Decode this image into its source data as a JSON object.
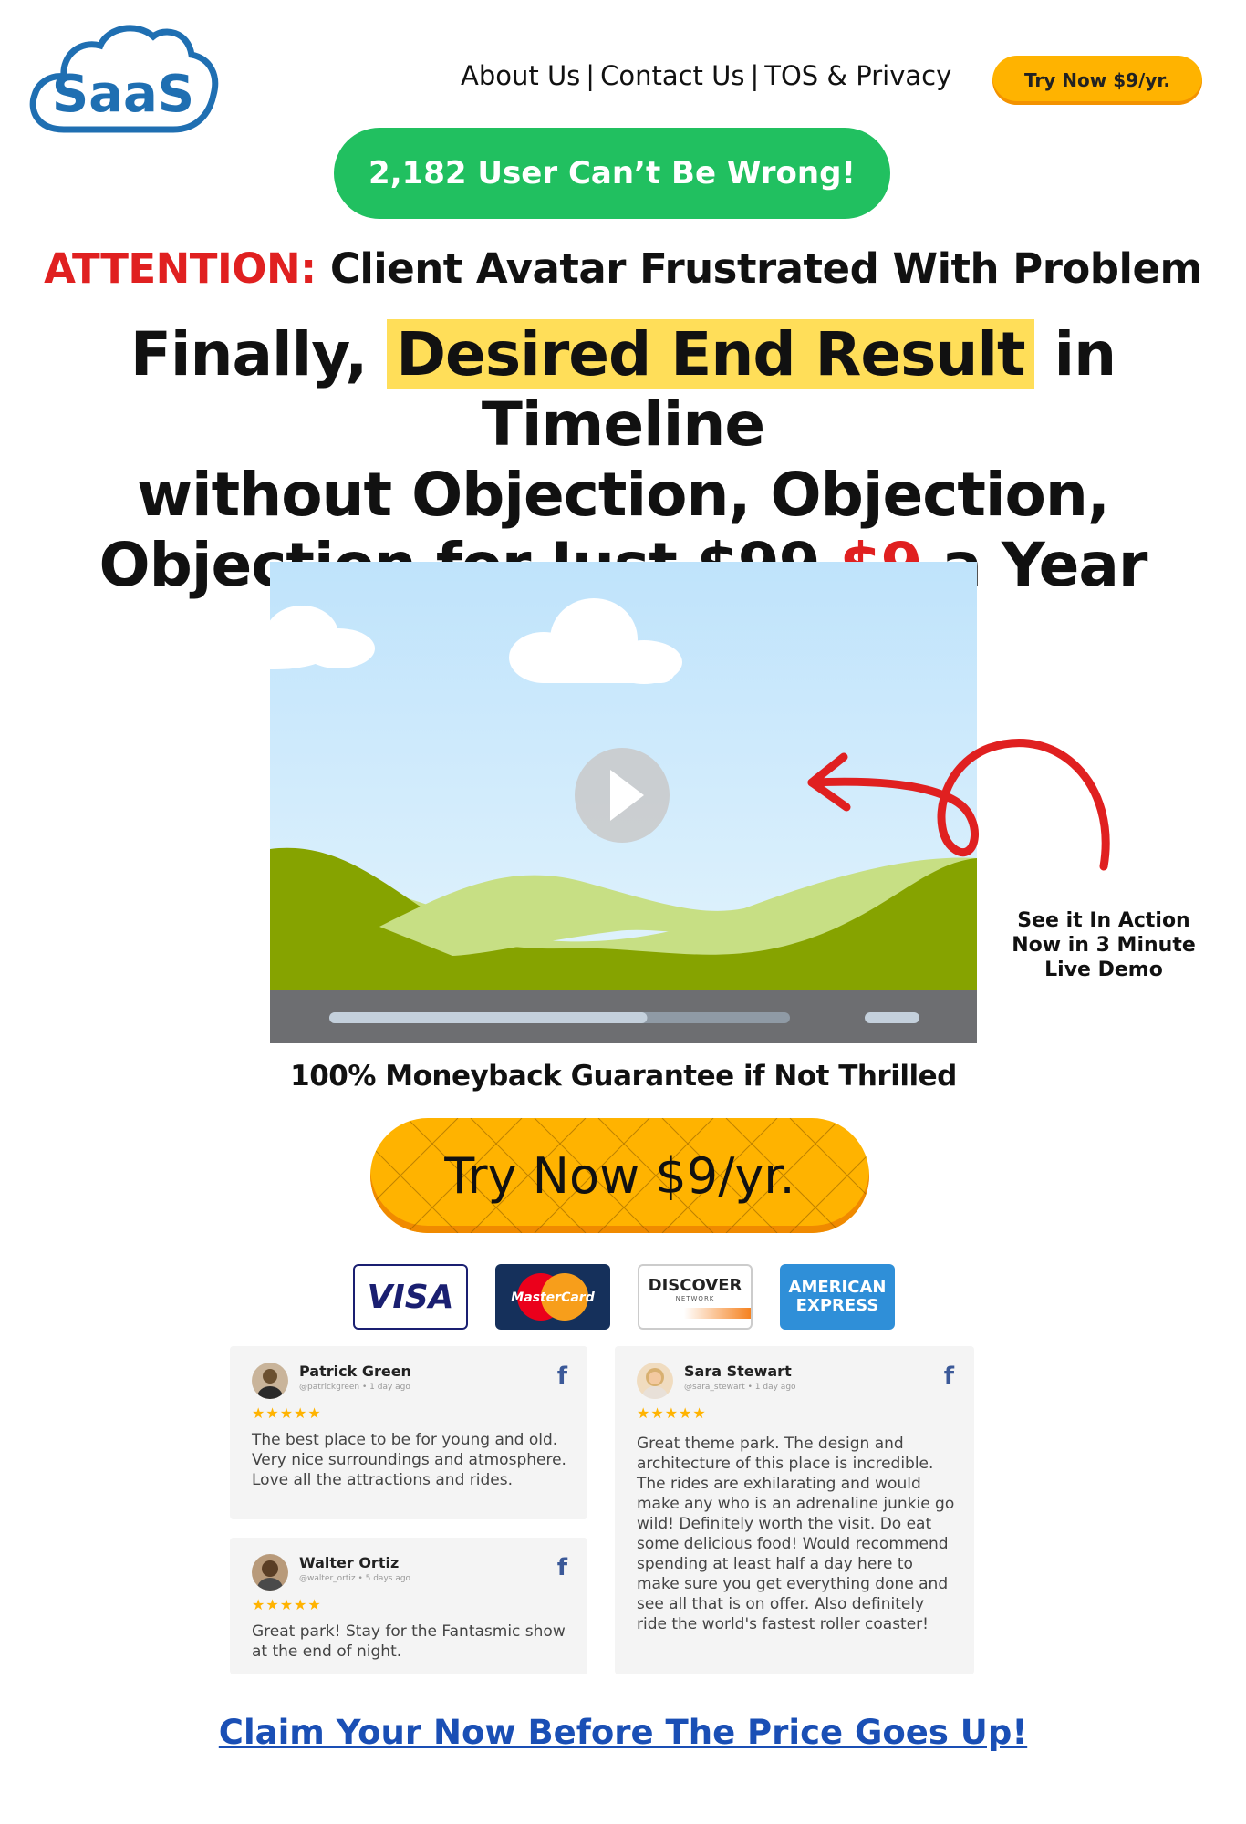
{
  "header": {
    "logo_text": "SaaS",
    "nav": [
      {
        "label": "About Us"
      },
      {
        "label": "Contact Us"
      },
      {
        "label": "TOS & Privacy"
      }
    ],
    "nav_separator": "|",
    "cta_label": "Try Now $9/yr."
  },
  "badge": {
    "label": "2,182 User Can’t Be Wrong!"
  },
  "attention": {
    "prefix": "ATTENTION:",
    "text": " Client Avatar Frustrated With Problem"
  },
  "headline": {
    "part1": "Finally, ",
    "highlight": "Desired End Result",
    "part2": " in Timeline",
    "line2": "without Objection, Objection,",
    "line3_pre": "Objection for Just ",
    "old_price": "$99",
    "new_price": "$9",
    "line3_post": " a Year"
  },
  "video": {
    "icon": "play-icon",
    "progress": 0.69
  },
  "side_note": {
    "text": "See it In Action Now in 3 Minute Live Demo"
  },
  "guarantee": {
    "text": "100% Moneyback Guarantee if Not Thrilled"
  },
  "main_cta": {
    "label": "Try Now $9/yr."
  },
  "payment_cards": {
    "visa": "VISA",
    "mastercard": "MasterCard",
    "discover": "DISCOVER",
    "discover_sub": "NETWORK",
    "amex_line1": "AMERICAN",
    "amex_line2": "EXPRESS"
  },
  "reviews": [
    {
      "name": "Patrick Green",
      "handle": "@patrickgreen • 1 day ago",
      "stars": "★★★★★",
      "network": "f",
      "text": "The best place to be for young and old. Very nice surroundings and atmosphere. Love all the attractions and rides."
    },
    {
      "name": "Walter Ortiz",
      "handle": "@walter_ortiz • 5 days ago",
      "stars": "★★★★★",
      "network": "f",
      "text": "Great park! Stay for the Fantasmic show at the end of night."
    },
    {
      "name": "Sara Stewart",
      "handle": "@sara_stewart • 1 day ago",
      "stars": "★★★★★",
      "network": "f",
      "text": "Great theme park. The design and architecture of this place is incredible. The rides are exhilarating and would make any who is an adrenaline junkie go wild! Definitely worth the visit. Do eat some delicious food! Would recommend spending at least half a day here to make sure you get everything done and see all that is on offer. Also definitely ride the world's fastest roller coaster!"
    }
  ],
  "footer_link": {
    "label": "Claim Your Now Before The Price Goes Up!"
  },
  "colors": {
    "accent_orange": "#ffb300",
    "badge_green": "#21c060",
    "attention_red": "#e02020",
    "highlight_yellow": "#ffde59",
    "link_blue": "#1a4fb5"
  }
}
